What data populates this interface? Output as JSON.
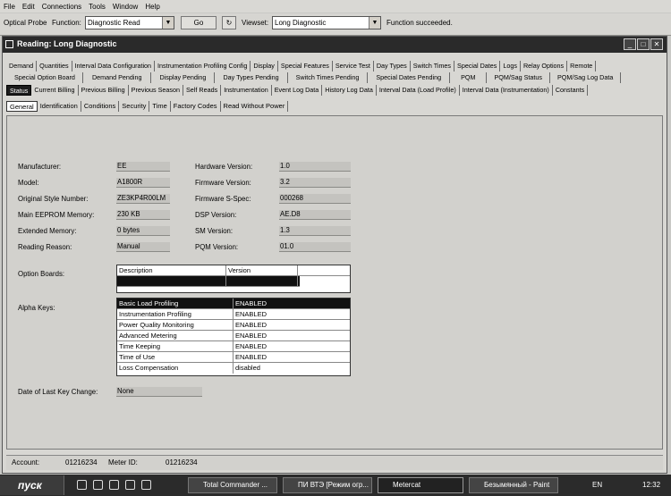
{
  "menu": [
    "File",
    "Edit",
    "Connections",
    "Tools",
    "Window",
    "Help"
  ],
  "toolbar": {
    "probe_label": "Optical Probe",
    "function_label": "Function:",
    "function_value": "Diagnostic Read",
    "go_label": "Go",
    "viewset_label": "Viewset:",
    "viewset_value": "Long Diagnostic",
    "status": "Function succeeded."
  },
  "window": {
    "title": "Reading: Long Diagnostic"
  },
  "tabs_row1": [
    "Demand",
    "Quantities",
    "Interval Data Configuration",
    "Instrumentation Profiling Config",
    "Display",
    "Special Features",
    "Service Test",
    "Day Types",
    "Switch Times",
    "Special Dates",
    "Logs",
    "Relay Options",
    "Remote"
  ],
  "tabs_row2": [
    "Special Option Board",
    "Demand Pending",
    "Display Pending",
    "Day Types Pending",
    "Switch Times Pending",
    "Special Dates Pending",
    "PQM",
    "PQM/Sag Status",
    "PQM/Sag Log Data"
  ],
  "tabs_row3": [
    "Status",
    "Current Billing",
    "Previous Billing",
    "Previous Season",
    "Self Reads",
    "Instrumentation",
    "Event Log Data",
    "History Log Data",
    "Interval Data (Load Profile)",
    "Interval Data (Instrumentation)",
    "Constants"
  ],
  "subtabs": [
    "General",
    "Identification",
    "Conditions",
    "Security",
    "Time",
    "Factory Codes",
    "Read Without Power"
  ],
  "general": {
    "manufacturer_label": "Manufacturer:",
    "manufacturer": "EE",
    "model_label": "Model:",
    "model": "A1800R",
    "style_label": "Original Style Number:",
    "style": "ZE3KP4R00LM",
    "eeprom_label": "Main EEPROM Memory:",
    "eeprom": "230 KB",
    "extmem_label": "Extended Memory:",
    "extmem": "0 bytes",
    "reason_label": "Reading Reason:",
    "reason": "Manual",
    "hw_label": "Hardware Version:",
    "hw": "1.0",
    "fw_label": "Firmware Version:",
    "fw": "3.2",
    "fwspec_label": "Firmware S-Spec:",
    "fwspec": "000268",
    "dsp_label": "DSP Version:",
    "dsp": "AE.D8",
    "sm_label": "SM Version:",
    "sm": "1.3",
    "pqm_label": "PQM Version:",
    "pqm": "01.0",
    "option_boards_label": "Option Boards:",
    "option_cols": [
      "Description",
      "Version"
    ],
    "alpha_keys_label": "Alpha Keys:",
    "alpha_keys": [
      {
        "name": "Basic Load Profiling",
        "state": "ENABLED"
      },
      {
        "name": "Instrumentation Profiling",
        "state": "ENABLED"
      },
      {
        "name": "Power Quality Monitoring",
        "state": "ENABLED"
      },
      {
        "name": "Advanced Metering",
        "state": "ENABLED"
      },
      {
        "name": "Time Keeping",
        "state": "ENABLED"
      },
      {
        "name": "Time of Use",
        "state": "ENABLED"
      },
      {
        "name": "Loss Compensation",
        "state": "disabled"
      }
    ],
    "last_key_label": "Date of Last Key Change:",
    "last_key": "None"
  },
  "statusbar": {
    "account_label": "Account:",
    "account": "01216234",
    "meter_label": "Meter ID:",
    "meter": "01216234"
  },
  "taskbar": {
    "start": "пуск",
    "tasks": [
      "Total Commander ...",
      "ПИ ВТЭ [Режим огр...",
      "Metercat",
      "Безымянный - Paint"
    ],
    "lang": "EN",
    "clock": "12:32"
  }
}
